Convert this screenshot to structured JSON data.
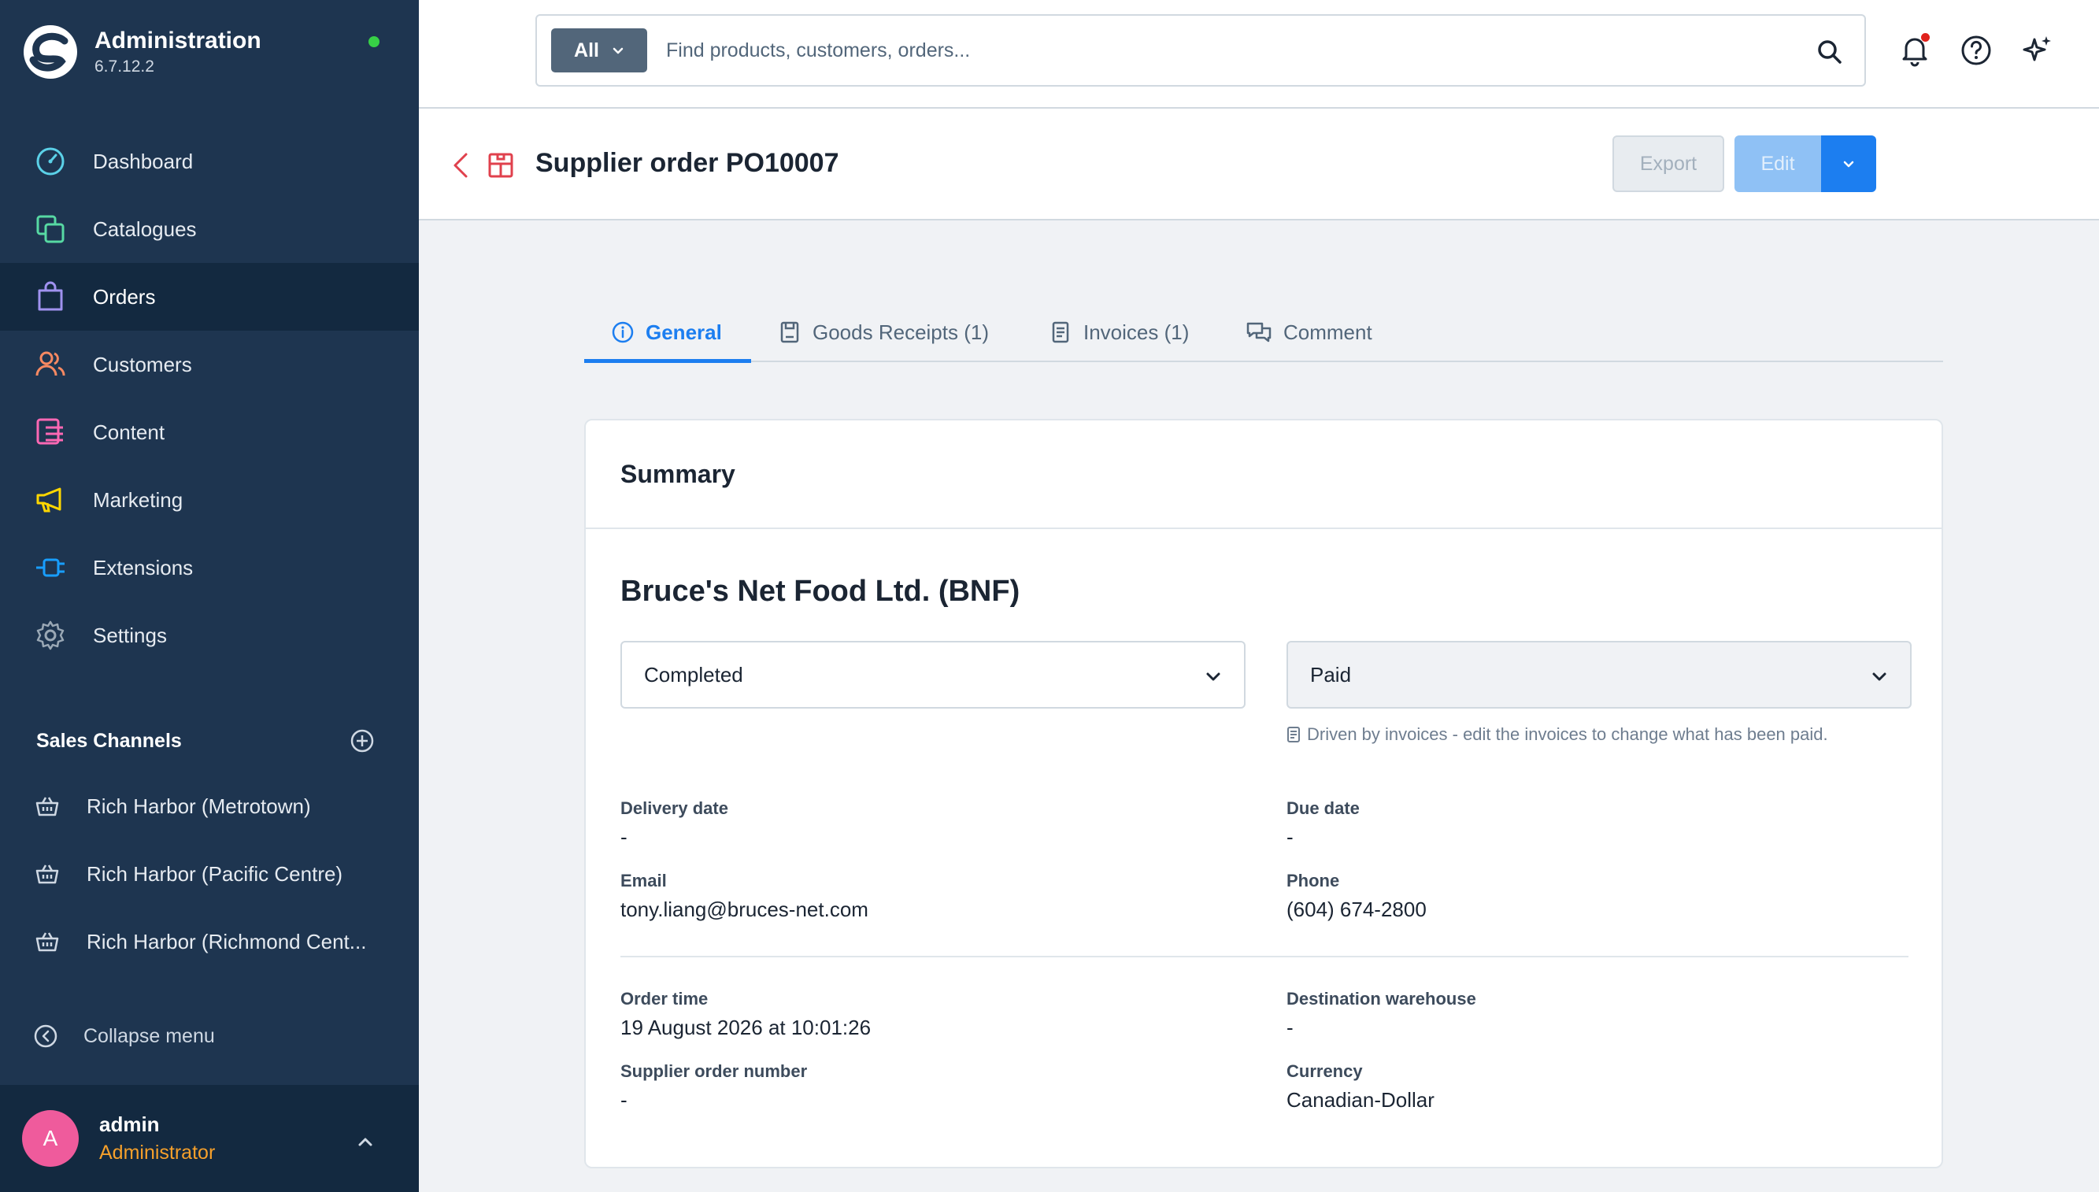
{
  "app": {
    "title": "Administration",
    "version": "6.7.12.2"
  },
  "sidebar": {
    "items": [
      {
        "label": "Dashboard",
        "icon": "dashboard-icon",
        "color": "#5bd1e8"
      },
      {
        "label": "Catalogues",
        "icon": "catalogue-icon",
        "color": "#57d9a3"
      },
      {
        "label": "Orders",
        "icon": "orders-icon",
        "color": "#a092f0",
        "active": true
      },
      {
        "label": "Customers",
        "icon": "customers-icon",
        "color": "#f88962"
      },
      {
        "label": "Content",
        "icon": "content-icon",
        "color": "#ff68b4"
      },
      {
        "label": "Marketing",
        "icon": "marketing-icon",
        "color": "#ffd700"
      },
      {
        "label": "Extensions",
        "icon": "extensions-icon",
        "color": "#189eff"
      },
      {
        "label": "Settings",
        "icon": "settings-icon",
        "color": "#9aa8b5"
      }
    ],
    "sales_channels_title": "Sales Channels",
    "sales_channels": [
      {
        "label": "Rich Harbor (Metrotown)"
      },
      {
        "label": "Rich Harbor (Pacific Centre)"
      },
      {
        "label": "Rich Harbor (Richmond Cent..."
      }
    ],
    "collapse_label": "Collapse menu",
    "user": {
      "initial": "A",
      "name": "admin",
      "role": "Administrator"
    }
  },
  "search": {
    "filter_label": "All",
    "placeholder": "Find products, customers, orders..."
  },
  "page": {
    "title": "Supplier order PO10007",
    "export_label": "Export",
    "edit_label": "Edit"
  },
  "tabs": [
    {
      "label": "General",
      "icon": "info-icon",
      "active": true
    },
    {
      "label": "Goods Receipts (1)",
      "icon": "receipt-icon"
    },
    {
      "label": "Invoices (1)",
      "icon": "invoice-icon"
    },
    {
      "label": "Comment",
      "icon": "comment-icon"
    }
  ],
  "summary": {
    "title": "Summary",
    "supplier": "Bruce's Net Food Ltd. (BNF)",
    "status": "Completed",
    "payment_status": "Paid",
    "payment_hint": "Driven by invoices - edit the invoices to change what has been paid.",
    "fields": {
      "delivery_date": {
        "label": "Delivery date",
        "value": "-"
      },
      "due_date": {
        "label": "Due date",
        "value": "-"
      },
      "email": {
        "label": "Email",
        "value": "tony.liang@bruces-net.com"
      },
      "phone": {
        "label": "Phone",
        "value": "(604) 674-2800"
      },
      "order_time": {
        "label": "Order time",
        "value": "19 August 2026 at 10:01:26"
      },
      "destination_warehouse": {
        "label": "Destination warehouse",
        "value": "-"
      },
      "supplier_order_number": {
        "label": "Supplier order number",
        "value": "-"
      },
      "currency": {
        "label": "Currency",
        "value": "Canadian-Dollar"
      }
    }
  },
  "colors": {
    "sidebar_bg": "#1e3550",
    "sidebar_active": "#132940",
    "accent": "#1c7ef0",
    "online": "#37d046",
    "role": "#f6a02b",
    "avatar": "#ef5b9c",
    "po_icon": "#e0414d"
  }
}
